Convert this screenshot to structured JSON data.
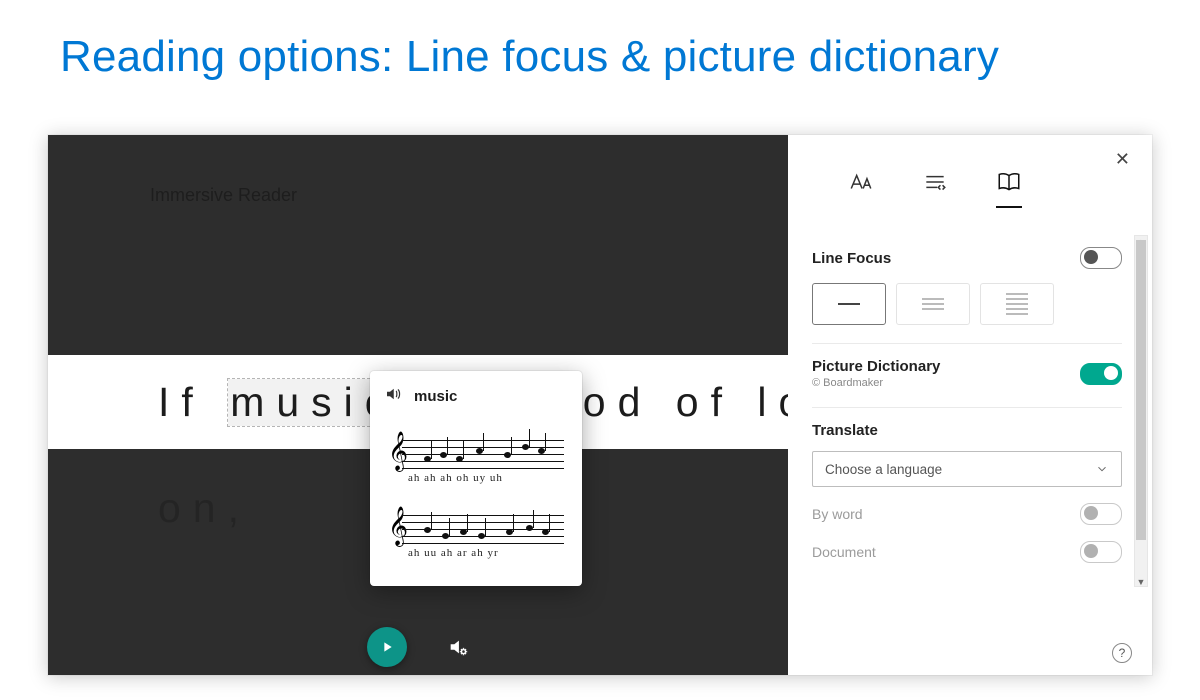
{
  "title": "Reading options: Line focus & picture dictionary",
  "reader": {
    "app_name": "Immersive Reader",
    "line_prefix": "If ",
    "highlighted_word": "music",
    "line_tail": "ood of lo",
    "second_line": "on,"
  },
  "popup": {
    "word": "music",
    "lyrics1": "ah ah ah oh    uy uh",
    "lyrics2": "ah uu  ah ar    ah yr"
  },
  "panel": {
    "line_focus_label": "Line Focus",
    "line_focus_on": false,
    "picture_dict_label": "Picture Dictionary",
    "picture_dict_sub": "© Boardmaker",
    "picture_dict_on": true,
    "translate_label": "Translate",
    "translate_placeholder": "Choose a language",
    "by_word_label": "By word",
    "document_label": "Document"
  },
  "icons": {
    "close": "✕",
    "help": "?"
  }
}
